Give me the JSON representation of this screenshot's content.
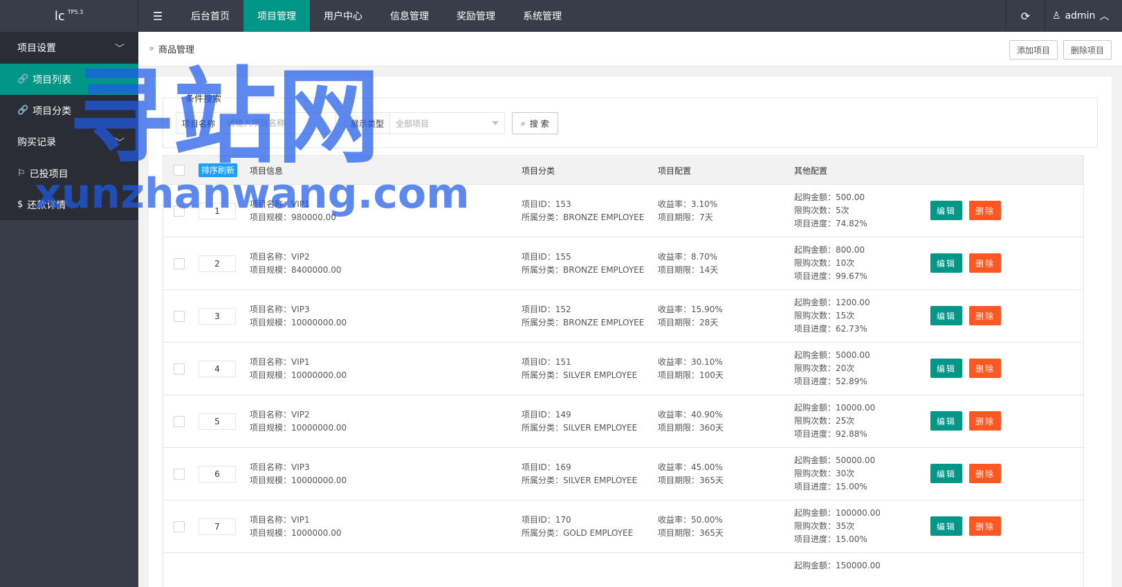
{
  "app": {
    "logo": "lc",
    "version": "TP5.3"
  },
  "topnav": {
    "menu_icon": "hamburger-icon",
    "items": [
      "后台首页",
      "项目管理",
      "用户中心",
      "信息管理",
      "奖励管理",
      "系统管理"
    ],
    "active": "项目管理",
    "refresh_icon": "refresh-icon",
    "user": "admin"
  },
  "sidebar": {
    "group1": "项目设置",
    "items1": [
      {
        "label": "项目列表",
        "icon": "link-icon",
        "active": true
      },
      {
        "label": "项目分类",
        "icon": "link-icon",
        "active": false
      }
    ],
    "group2": "购买记录",
    "items2": [
      {
        "label": "已投项目",
        "icon": "flag-icon"
      },
      {
        "label": "还款详情",
        "icon": "dollar-icon"
      }
    ]
  },
  "header": {
    "title": "商品管理",
    "add_button": "添加项目",
    "delete_button": "删除项目"
  },
  "search": {
    "legend": "条件搜索",
    "name_label": "项目名称",
    "name_placeholder": "请输入项目名称",
    "type_label": "展示类型",
    "type_value": "全部项目",
    "search_button": "搜 索"
  },
  "table": {
    "sort_button": "排序刷新",
    "headers": [
      "项目信息",
      "项目分类",
      "项目配置",
      "其他配置"
    ],
    "edit_label": "编辑",
    "delete_label": "删除",
    "rows": [
      {
        "order": "1",
        "name": "项目名称：VIP1",
        "scale": "项目规模：980000.00",
        "id": "项目ID：153",
        "category": "所属分类：BRONZE EMPLOYEE",
        "rate": "收益率：3.10%",
        "term": "项目期限：7天",
        "min": "起购金额：500.00",
        "limit": "限购次数：5次",
        "progress": "项目进度：74.82%"
      },
      {
        "order": "2",
        "name": "项目名称：VIP2",
        "scale": "项目规模：8400000.00",
        "id": "项目ID：155",
        "category": "所属分类：BRONZE EMPLOYEE",
        "rate": "收益率：8.70%",
        "term": "项目期限：14天",
        "min": "起购金额：800.00",
        "limit": "限购次数：10次",
        "progress": "项目进度：99.67%"
      },
      {
        "order": "3",
        "name": "项目名称：VIP3",
        "scale": "项目规模：10000000.00",
        "id": "项目ID：152",
        "category": "所属分类：BRONZE EMPLOYEE",
        "rate": "收益率：15.90%",
        "term": "项目期限：28天",
        "min": "起购金额：1200.00",
        "limit": "限购次数：15次",
        "progress": "项目进度：62.73%"
      },
      {
        "order": "4",
        "name": "项目名称：VIP1",
        "scale": "项目规模：10000000.00",
        "id": "项目ID：151",
        "category": "所属分类：SILVER EMPLOYEE",
        "rate": "收益率：30.10%",
        "term": "项目期限：100天",
        "min": "起购金额：5000.00",
        "limit": "限购次数：20次",
        "progress": "项目进度：52.89%"
      },
      {
        "order": "5",
        "name": "项目名称：VIP2",
        "scale": "项目规模：10000000.00",
        "id": "项目ID：149",
        "category": "所属分类：SILVER EMPLOYEE",
        "rate": "收益率：40.90%",
        "term": "项目期限：360天",
        "min": "起购金额：10000.00",
        "limit": "限购次数：25次",
        "progress": "项目进度：92.88%"
      },
      {
        "order": "6",
        "name": "项目名称：VIP3",
        "scale": "项目规模：10000000.00",
        "id": "项目ID：169",
        "category": "所属分类：SILVER EMPLOYEE",
        "rate": "收益率：45.00%",
        "term": "项目期限：365天",
        "min": "起购金额：50000.00",
        "limit": "限购次数：30次",
        "progress": "项目进度：15.00%"
      },
      {
        "order": "7",
        "name": "项目名称：VIP1",
        "scale": "项目规模：1000000.00",
        "id": "项目ID：170",
        "category": "所属分类：GOLD EMPLOYEE",
        "rate": "收益率：50.00%",
        "term": "项目期限：365天",
        "min": "起购金额：100000.00",
        "limit": "限购次数：35次",
        "progress": "项目进度：15.00%"
      },
      {
        "order": "",
        "name": "",
        "scale": "",
        "id": "",
        "category": "",
        "rate": "",
        "term": "",
        "min": "起购金额：150000.00",
        "limit": "",
        "progress": ""
      }
    ]
  },
  "watermark": {
    "cn": "寻站网",
    "en": "xunzhanwang.com"
  },
  "colors": {
    "topbar": "#393d49",
    "sidebar": "#2a2d36",
    "accent": "#009688",
    "danger": "#ff5722",
    "info": "#1e9fff"
  }
}
